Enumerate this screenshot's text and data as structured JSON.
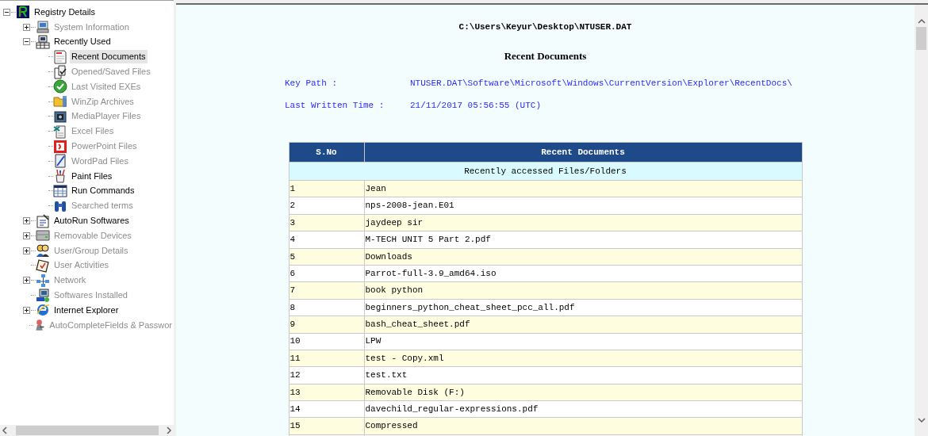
{
  "tree": [
    {
      "label": "Registry Details",
      "enabled": true,
      "selected": false,
      "expanded": true,
      "children": [
        {
          "label": "System Information",
          "enabled": false,
          "selected": false,
          "expanded": false
        },
        {
          "label": "Recently Used",
          "enabled": true,
          "selected": false,
          "expanded": true,
          "children": [
            {
              "label": "Recent Documents",
              "enabled": true,
              "selected": true
            },
            {
              "label": "Opened/Saved Files",
              "enabled": false,
              "selected": false
            },
            {
              "label": "Last Visited EXEs",
              "enabled": false,
              "selected": false
            },
            {
              "label": "WinZip Archives",
              "enabled": false,
              "selected": false
            },
            {
              "label": "MediaPlayer Files",
              "enabled": false,
              "selected": false
            },
            {
              "label": "Excel Files",
              "enabled": false,
              "selected": false
            },
            {
              "label": "PowerPoint Files",
              "enabled": false,
              "selected": false
            },
            {
              "label": "WordPad Files",
              "enabled": false,
              "selected": false
            },
            {
              "label": "Paint Files",
              "enabled": true,
              "selected": false
            },
            {
              "label": "Run Commands",
              "enabled": true,
              "selected": false
            },
            {
              "label": "Searched terms",
              "enabled": false,
              "selected": false
            }
          ]
        },
        {
          "label": "AutoRun Softwares",
          "enabled": true,
          "selected": false,
          "expanded": false
        },
        {
          "label": "Removable Devices",
          "enabled": false,
          "selected": false,
          "expanded": false
        },
        {
          "label": "User/Group Details",
          "enabled": false,
          "selected": false,
          "expanded": false
        },
        {
          "label": "User Activities",
          "enabled": false,
          "selected": false
        },
        {
          "label": "Network",
          "enabled": false,
          "selected": false,
          "expanded": false
        },
        {
          "label": "Softwares Installed",
          "enabled": false,
          "selected": false
        },
        {
          "label": "Internet Explorer",
          "enabled": true,
          "selected": false,
          "expanded": false
        },
        {
          "label": "AutoCompleteFields & Passwor",
          "enabled": false,
          "selected": false
        }
      ]
    }
  ],
  "report": {
    "file_path": "C:\\Users\\Keyur\\Desktop\\NTUSER.DAT",
    "title": "Recent Documents",
    "fields": [
      {
        "label": "Key Path :",
        "value": "NTUSER.DAT\\Software\\Microsoft\\Windows\\CurrentVersion\\Explorer\\RecentDocs\\"
      },
      {
        "label": "Last Written Time :",
        "value": "21/11/2017 05:56:55 (UTC)"
      }
    ],
    "table": {
      "columns": [
        "S.No",
        "Recent Documents"
      ],
      "group": "Recently accessed Files/Folders",
      "rows": [
        [
          "1",
          "Jean"
        ],
        [
          "2",
          "nps-2008-jean.E01"
        ],
        [
          "3",
          "jaydeep sir"
        ],
        [
          "4",
          "M-TECH UNIT 5 Part 2.pdf"
        ],
        [
          "5",
          "Downloads"
        ],
        [
          "6",
          "Parrot-full-3.9_amd64.iso"
        ],
        [
          "7",
          "book python"
        ],
        [
          "8",
          "beginners_python_cheat_sheet_pcc_all.pdf"
        ],
        [
          "9",
          "bash_cheat_sheet.pdf"
        ],
        [
          "10",
          "LPW"
        ],
        [
          "11",
          "test - Copy.xml"
        ],
        [
          "12",
          "test.txt"
        ],
        [
          "13",
          "Removable Disk (F:)"
        ],
        [
          "14",
          "davechild_regular-expressions.pdf"
        ],
        [
          "15",
          "Compressed"
        ]
      ]
    }
  }
}
